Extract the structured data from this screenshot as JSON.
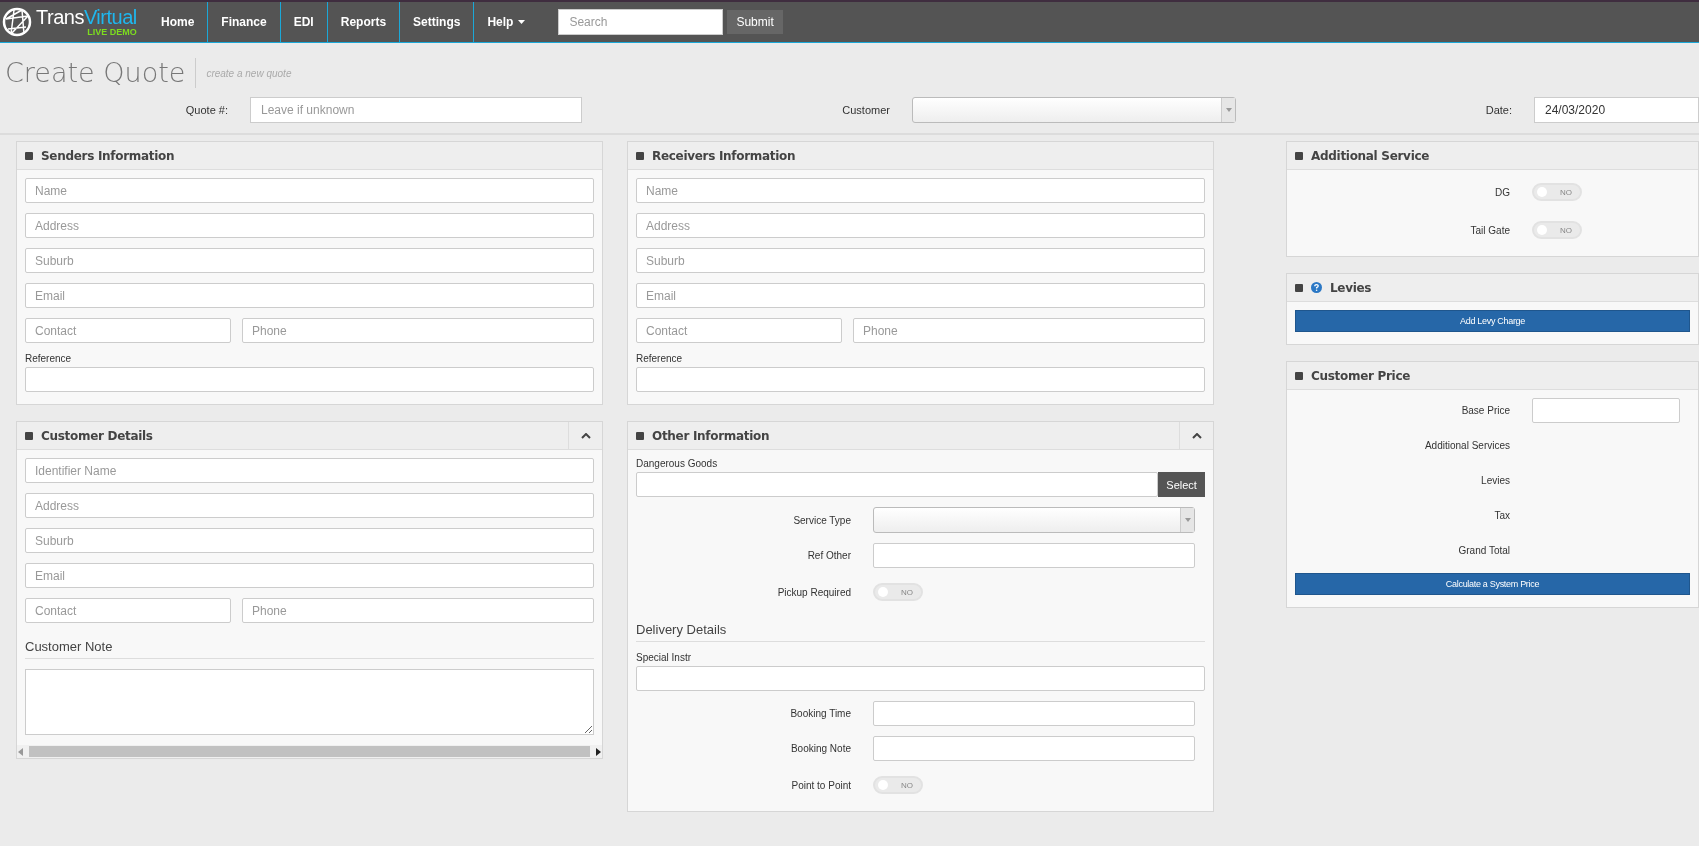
{
  "nav": {
    "brand_first": "Trans",
    "brand_second": "Virtual",
    "tagline": "LIVE DEMO",
    "menu": [
      {
        "label": "Home",
        "dropdown": false
      },
      {
        "label": "Finance",
        "dropdown": false
      },
      {
        "label": "EDI",
        "dropdown": false
      },
      {
        "label": "Reports",
        "dropdown": false
      },
      {
        "label": "Settings",
        "dropdown": false
      },
      {
        "label": "Help",
        "dropdown": true
      }
    ],
    "search": {
      "placeholder": "Search",
      "button": "Submit"
    }
  },
  "page": {
    "title": "Create Quote",
    "subtitle": "create a new quote"
  },
  "header_fields": {
    "quote": {
      "label": "Quote #:",
      "placeholder": "Leave if unknown"
    },
    "customer": {
      "label": "Customer"
    },
    "date": {
      "label": "Date:",
      "value": "24/03/2020"
    }
  },
  "columns": [
    [
      {
        "title": "Senders Information",
        "collapsible": false,
        "help": false,
        "rows": [
          {
            "kind": "inputs",
            "placeholders": [
              "Name"
            ]
          },
          {
            "kind": "inputs",
            "placeholders": [
              "Address"
            ]
          },
          {
            "kind": "inputs",
            "placeholders": [
              "Suburb"
            ]
          },
          {
            "kind": "inputs",
            "placeholders": [
              "Email"
            ]
          },
          {
            "kind": "inputs",
            "placeholders": [
              "Contact",
              "Phone"
            ]
          },
          {
            "kind": "labeled_input",
            "label": "Reference"
          }
        ]
      },
      {
        "title": "Customer Details",
        "collapsible": true,
        "help": false,
        "rows": [
          {
            "kind": "inputs",
            "placeholders": [
              "Identifier Name"
            ]
          },
          {
            "kind": "inputs",
            "placeholders": [
              "Address"
            ]
          },
          {
            "kind": "inputs",
            "placeholders": [
              "Suburb"
            ]
          },
          {
            "kind": "inputs",
            "placeholders": [
              "Email"
            ]
          },
          {
            "kind": "inputs",
            "placeholders": [
              "Contact",
              "Phone"
            ]
          },
          {
            "kind": "heading",
            "label": "Customer Note"
          },
          {
            "kind": "textarea"
          },
          {
            "kind": "scrollbar"
          }
        ]
      }
    ],
    [
      {
        "title": "Receivers Information",
        "collapsible": false,
        "help": false,
        "rows": [
          {
            "kind": "inputs",
            "placeholders": [
              "Name"
            ]
          },
          {
            "kind": "inputs",
            "placeholders": [
              "Address"
            ]
          },
          {
            "kind": "inputs",
            "placeholders": [
              "Suburb"
            ]
          },
          {
            "kind": "inputs",
            "placeholders": [
              "Email"
            ]
          },
          {
            "kind": "inputs",
            "placeholders": [
              "Contact",
              "Phone"
            ]
          },
          {
            "kind": "labeled_input",
            "label": "Reference"
          }
        ]
      },
      {
        "title": "Other Information",
        "collapsible": true,
        "help": false,
        "rows": [
          {
            "kind": "input_button",
            "label": "Dangerous Goods",
            "button": "Select"
          },
          {
            "kind": "side_select",
            "label": "Service Type"
          },
          {
            "kind": "side_input",
            "label": "Ref Other"
          },
          {
            "kind": "side_toggle",
            "label": "Pickup Required",
            "on": false,
            "state_text": "NO"
          },
          {
            "kind": "heading",
            "label": "Delivery Details"
          },
          {
            "kind": "labeled_input",
            "label": "Special Instr"
          },
          {
            "kind": "side_input",
            "label": "Booking Time"
          },
          {
            "kind": "side_input",
            "label": "Booking Note"
          },
          {
            "kind": "side_toggle",
            "label": "Point to Point",
            "on": false,
            "state_text": "NO"
          }
        ]
      }
    ],
    [
      {
        "title": "Additional Service",
        "collapsible": false,
        "help": false,
        "rows": [
          {
            "kind": "side_toggle",
            "label": "DG",
            "on": false,
            "state_text": "NO"
          },
          {
            "kind": "side_toggle",
            "label": "Tail Gate",
            "on": false,
            "state_text": "NO"
          }
        ]
      },
      {
        "title": "Levies",
        "collapsible": false,
        "help": true,
        "rows": [
          {
            "kind": "wide_button",
            "label": "Add Levy Charge"
          }
        ]
      },
      {
        "title": "Customer Price",
        "collapsible": false,
        "help": false,
        "rows": [
          {
            "kind": "side_input",
            "label": "Base Price"
          },
          {
            "kind": "side_text",
            "label": "Additional Services"
          },
          {
            "kind": "side_text",
            "label": "Levies"
          },
          {
            "kind": "side_text",
            "label": "Tax"
          },
          {
            "kind": "side_text",
            "label": "Grand Total"
          },
          {
            "kind": "wide_button",
            "label": "Calculate a System Price"
          }
        ]
      }
    ]
  ]
}
